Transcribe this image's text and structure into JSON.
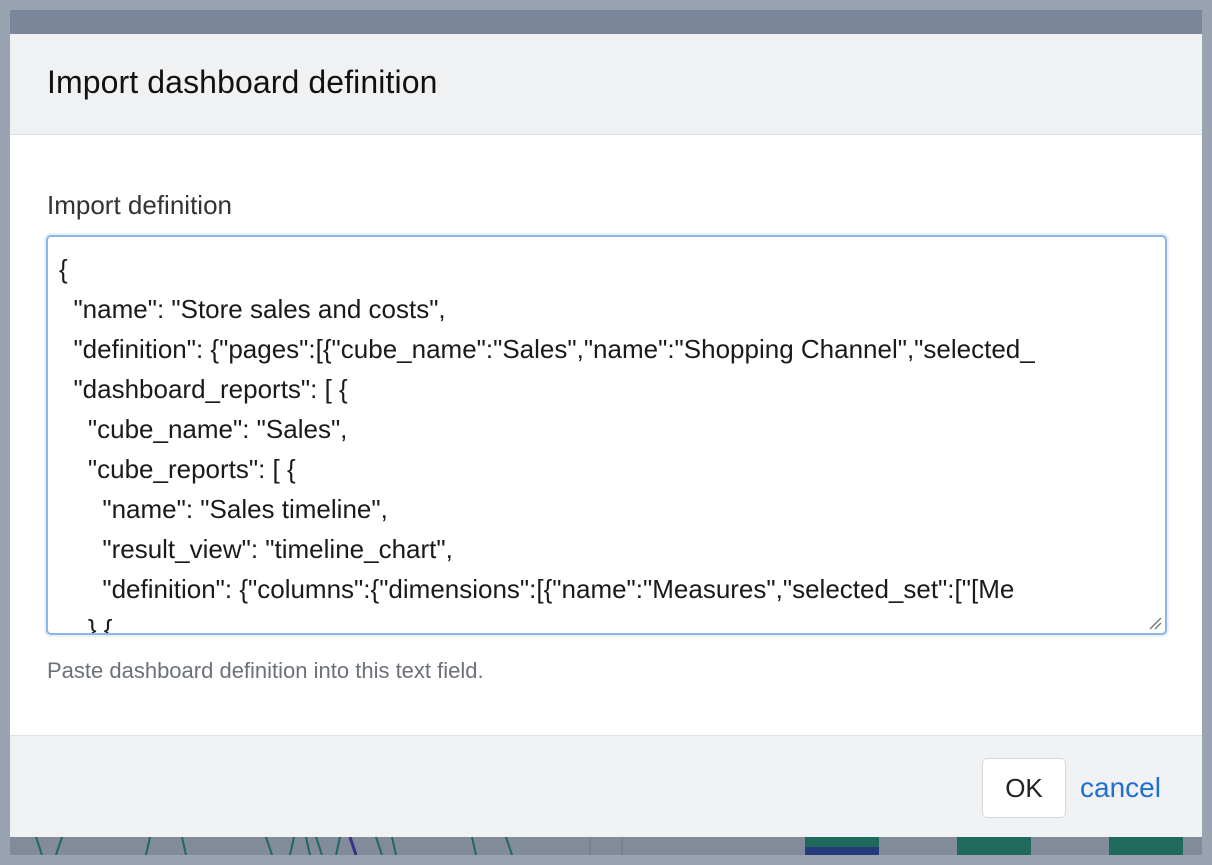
{
  "dialog": {
    "title": "Import dashboard definition",
    "field_label": "Import definition",
    "textarea_value": "{\n  \"name\": \"Store sales and costs\",\n  \"definition\": {\"pages\":[{\"cube_name\":\"Sales\",\"name\":\"Shopping Channel\",\"selected_\n  \"dashboard_reports\": [ {\n    \"cube_name\": \"Sales\",\n    \"cube_reports\": [ {\n      \"name\": \"Sales timeline\",\n      \"result_view\": \"timeline_chart\",\n      \"definition\": {\"columns\":{\"dimensions\":[{\"name\":\"Measures\",\"selected_set\":[\"[Me\n    },{",
    "help_text": "Paste dashboard definition into this text field."
  },
  "footer": {
    "ok_label": "OK",
    "cancel_label": "cancel"
  },
  "colors": {
    "accent_link": "#1f6fd1",
    "focus_border": "#8db5e8",
    "header_bg": "#f0f1f3",
    "backdrop": "#9aa3b2"
  }
}
